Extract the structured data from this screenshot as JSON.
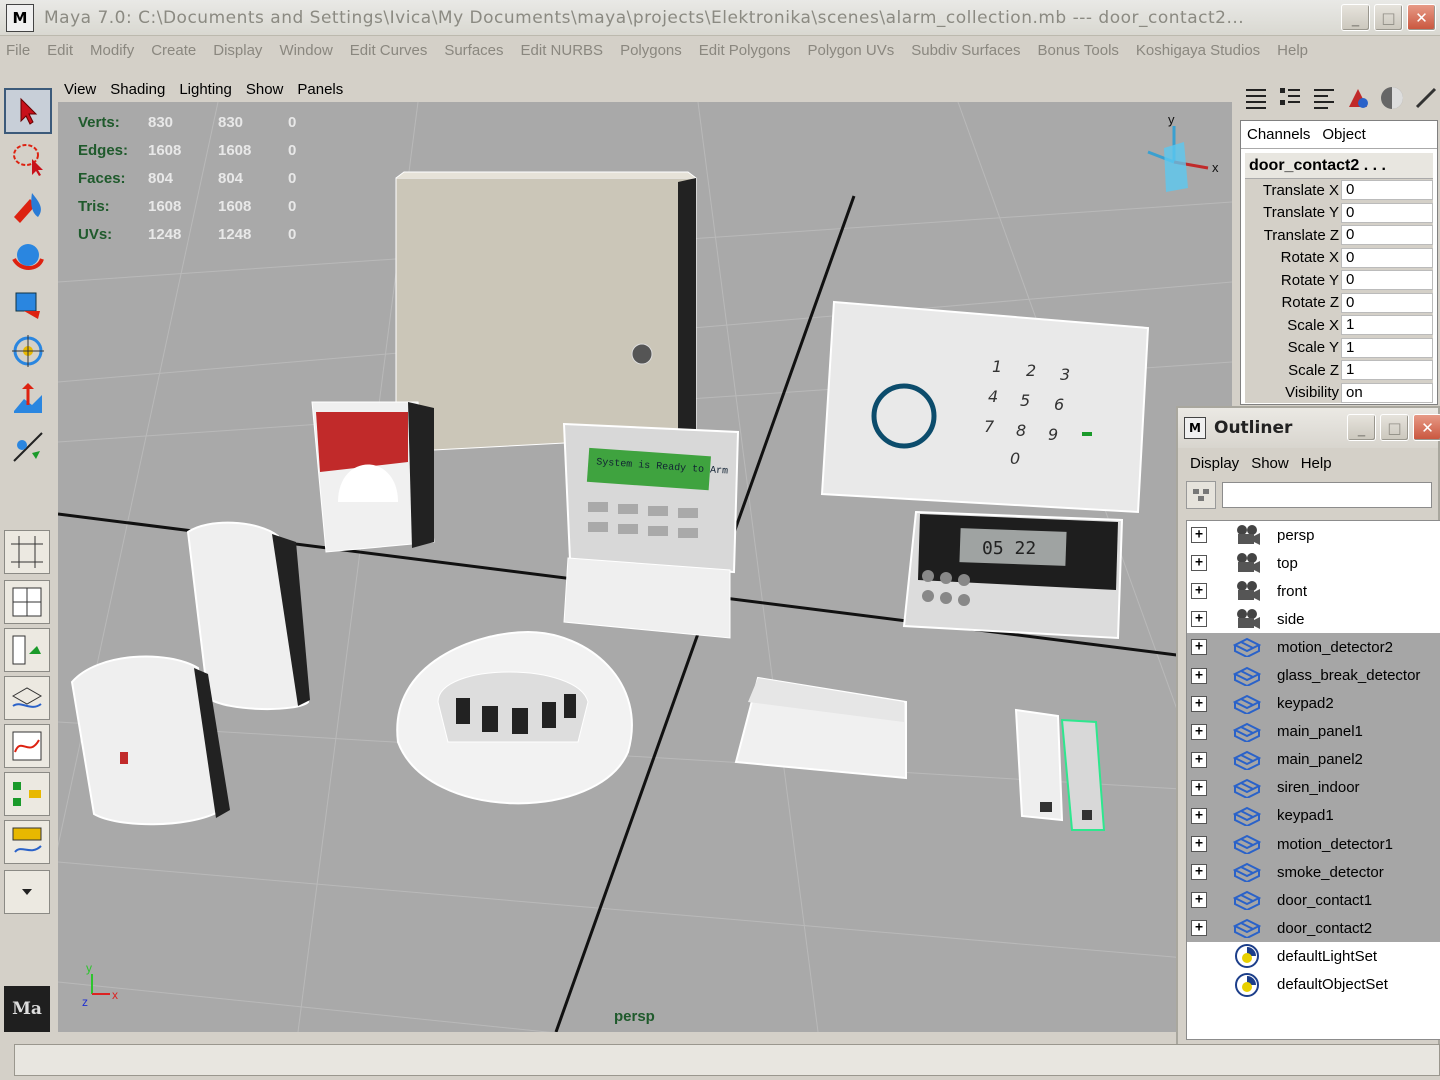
{
  "window": {
    "title": "Maya 7.0: C:\\Documents and Settings\\Ivica\\My Documents\\maya\\projects\\Elektronika\\scenes\\alarm_collection.mb   ---   door_contact2...",
    "controls": {
      "minimize": "_",
      "maximize": "□",
      "close": "✕"
    }
  },
  "menubar": [
    "File",
    "Edit",
    "Modify",
    "Create",
    "Display",
    "Window",
    "Edit Curves",
    "Surfaces",
    "Edit NURBS",
    "Polygons",
    "Edit Polygons",
    "Polygon UVs",
    "Subdiv Surfaces",
    "Bonus Tools",
    "Koshigaya Studios",
    "Help"
  ],
  "panel_menu": [
    "View",
    "Shading",
    "Lighting",
    "Show",
    "Panels"
  ],
  "hud": [
    {
      "label": "Verts:",
      "values": [
        "830",
        "830",
        "0"
      ]
    },
    {
      "label": "Edges:",
      "values": [
        "1608",
        "1608",
        "0"
      ]
    },
    {
      "label": "Faces:",
      "values": [
        "804",
        "804",
        "0"
      ]
    },
    {
      "label": "Tris:",
      "values": [
        "1608",
        "1608",
        "0"
      ]
    },
    {
      "label": "UVs:",
      "values": [
        "1248",
        "1248",
        "0"
      ]
    }
  ],
  "viewport": {
    "camera_label": "persp",
    "keypad_lcd": "System is Ready to Arm",
    "panel_display": "05 22",
    "numpad": [
      "1",
      "2",
      "3",
      "4",
      "5",
      "6",
      "7",
      "8",
      "9",
      "0"
    ],
    "axis": {
      "x": "x",
      "y": "y",
      "z": "z"
    }
  },
  "channel_box": {
    "tabs": [
      "Channels",
      "Object"
    ],
    "object_name": "door_contact2 . . .",
    "attributes": [
      {
        "name": "Translate X",
        "value": "0"
      },
      {
        "name": "Translate Y",
        "value": "0"
      },
      {
        "name": "Translate Z",
        "value": "0"
      },
      {
        "name": "Rotate X",
        "value": "0"
      },
      {
        "name": "Rotate Y",
        "value": "0"
      },
      {
        "name": "Rotate Z",
        "value": "0"
      },
      {
        "name": "Scale X",
        "value": "1"
      },
      {
        "name": "Scale Y",
        "value": "1"
      },
      {
        "name": "Scale Z",
        "value": "1"
      },
      {
        "name": "Visibility",
        "value": "on"
      }
    ]
  },
  "outliner": {
    "title": "Outliner",
    "menu": [
      "Display",
      "Show",
      "Help"
    ],
    "filter_value": "",
    "items": [
      {
        "name": "persp",
        "type": "camera",
        "expand": "+",
        "selected": false
      },
      {
        "name": "top",
        "type": "camera",
        "expand": "+",
        "selected": false
      },
      {
        "name": "front",
        "type": "camera",
        "expand": "+",
        "selected": false
      },
      {
        "name": "side",
        "type": "camera",
        "expand": "+",
        "selected": false
      },
      {
        "name": "motion_detector2",
        "type": "mesh",
        "expand": "+",
        "selected": true
      },
      {
        "name": "glass_break_detector",
        "type": "mesh",
        "expand": "+",
        "selected": true
      },
      {
        "name": "keypad2",
        "type": "mesh",
        "expand": "+",
        "selected": true
      },
      {
        "name": "main_panel1",
        "type": "mesh",
        "expand": "+",
        "selected": true
      },
      {
        "name": "main_panel2",
        "type": "mesh",
        "expand": "+",
        "selected": true
      },
      {
        "name": "siren_indoor",
        "type": "mesh",
        "expand": "+",
        "selected": true
      },
      {
        "name": "keypad1",
        "type": "mesh",
        "expand": "+",
        "selected": true
      },
      {
        "name": "motion_detector1",
        "type": "mesh",
        "expand": "+",
        "selected": true
      },
      {
        "name": "smoke_detector",
        "type": "mesh",
        "expand": "+",
        "selected": true
      },
      {
        "name": "door_contact1",
        "type": "mesh",
        "expand": "+",
        "selected": true
      },
      {
        "name": "door_contact2",
        "type": "mesh",
        "expand": "+",
        "selected": true
      },
      {
        "name": "defaultLightSet",
        "type": "set",
        "expand": "",
        "selected": false
      },
      {
        "name": "defaultObjectSet",
        "type": "set",
        "expand": "",
        "selected": false
      }
    ]
  },
  "toolbox": [
    "select-tool",
    "lasso-tool",
    "paint-select-tool",
    "move-tool",
    "rotate-tool",
    "scale-tool",
    "manipulator-tool",
    "show-manipulator-tool",
    "last-used-tool"
  ],
  "colors": {
    "viewport_bg": "#a9a9a9",
    "hud_green": "#1f5a2c",
    "selection_gray": "#a6a6a6",
    "mesh_icon_blue": "#2a62c9"
  }
}
